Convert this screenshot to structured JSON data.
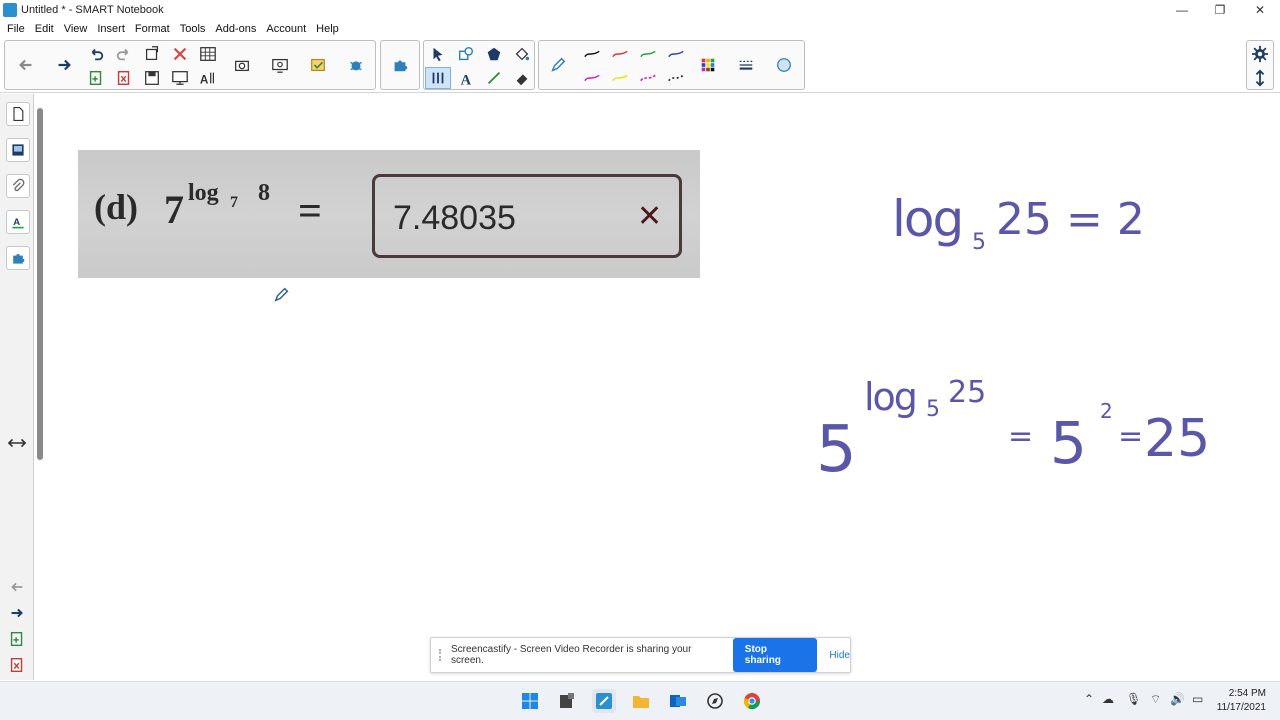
{
  "window": {
    "title": "Untitled * - SMART Notebook",
    "min_glyph": "—",
    "max_glyph": "❐",
    "close_glyph": "✕"
  },
  "menu": [
    "File",
    "Edit",
    "View",
    "Insert",
    "Format",
    "Tools",
    "Add-ons",
    "Account",
    "Help"
  ],
  "photo": {
    "label": "(d)",
    "base": "7",
    "exponent_log": "log",
    "exponent_sub": "7",
    "exponent_arg": "8",
    "equals": "=",
    "answer": "7.48035",
    "mark": "✕"
  },
  "handwriting": {
    "eq1": "log",
    "eq1_base": "5",
    "eq1_rest": "25 = 2",
    "eq2_base": "5",
    "eq2_exp_log": "log",
    "eq2_exp_sub": "5",
    "eq2_exp_arg": "25",
    "eq2_eq1": "=",
    "eq2_five": "5",
    "eq2_sq": "2",
    "eq2_eq2": "=",
    "eq2_res": "25"
  },
  "share": {
    "message": "Screencastify - Screen Video Recorder is sharing your screen.",
    "stop_label": "Stop sharing",
    "hide_label": "Hide"
  },
  "clock": {
    "time": "2:54 PM",
    "date": "11/17/2021"
  },
  "colors": {
    "ink": "#5a56a8",
    "accent": "#1a73e8"
  }
}
